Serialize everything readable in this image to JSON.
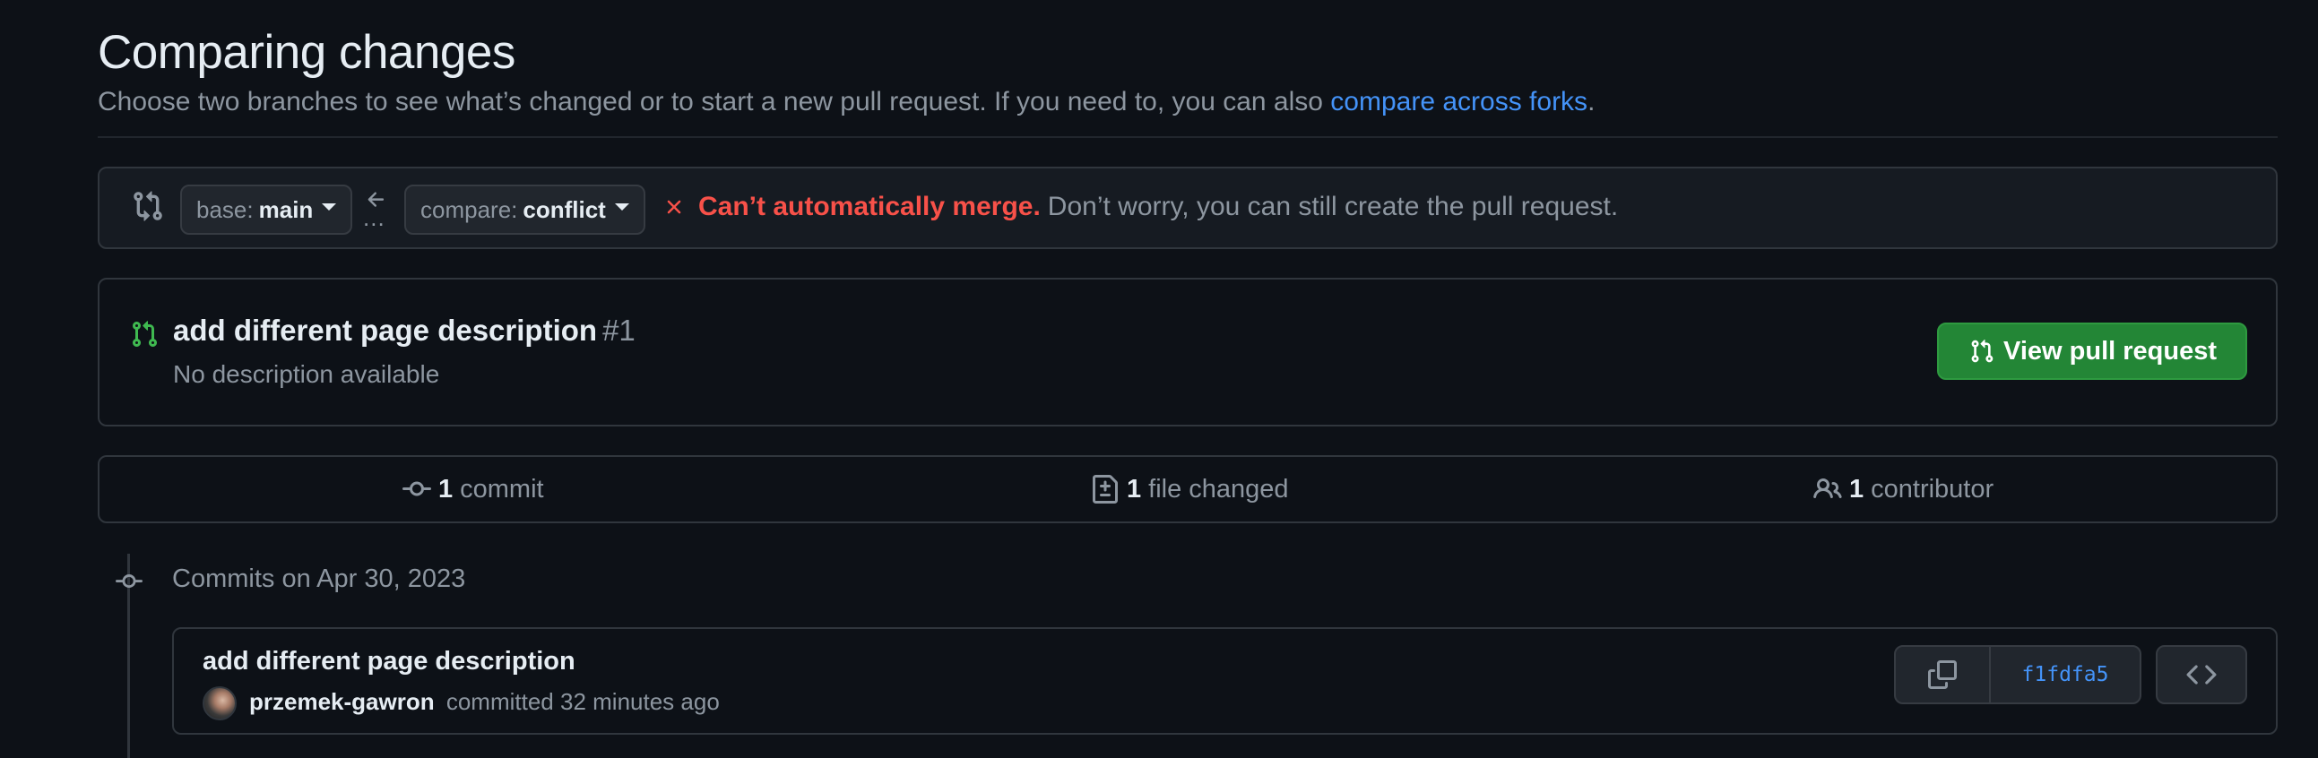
{
  "page": {
    "title": "Comparing changes",
    "subtitle_text": "Choose two branches to see what’s changed or to start a new pull request. If you need to, you can also ",
    "subtitle_link": "compare across forks",
    "subtitle_end": "."
  },
  "range": {
    "base_prefix": "base:",
    "base_branch": "main",
    "compare_prefix": "compare:",
    "compare_branch": "conflict",
    "dots": "...",
    "merge_status_strong": "Can’t automatically merge.",
    "merge_status_text": "Don’t worry, you can still create the pull request."
  },
  "existing_pr": {
    "title": "add different page description",
    "number": "#1",
    "description": "No description available",
    "view_button": "View pull request"
  },
  "stats": {
    "commits_count": "1",
    "commits_label": "commit",
    "files_count": "1",
    "files_label": "file changed",
    "contributors_count": "1",
    "contributors_label": "contributor"
  },
  "commits": {
    "date_heading": "Commits on Apr 30, 2023",
    "items": [
      {
        "message": "add different page description",
        "author": "przemek-gawron",
        "meta": "committed 32 minutes ago",
        "sha": "f1fdfa5"
      }
    ]
  },
  "colors": {
    "background": "#0d1117",
    "border": "#30363d",
    "muted_text": "#8d96a0",
    "link": "#4493f8",
    "danger": "#f85149",
    "success": "#238636",
    "open_icon": "#3fb950"
  },
  "icons": [
    "git-compare-icon",
    "arrow-left-icon",
    "x-icon",
    "git-pull-request-icon",
    "git-commit-icon",
    "file-diff-icon",
    "people-icon",
    "copy-icon",
    "code-icon"
  ]
}
